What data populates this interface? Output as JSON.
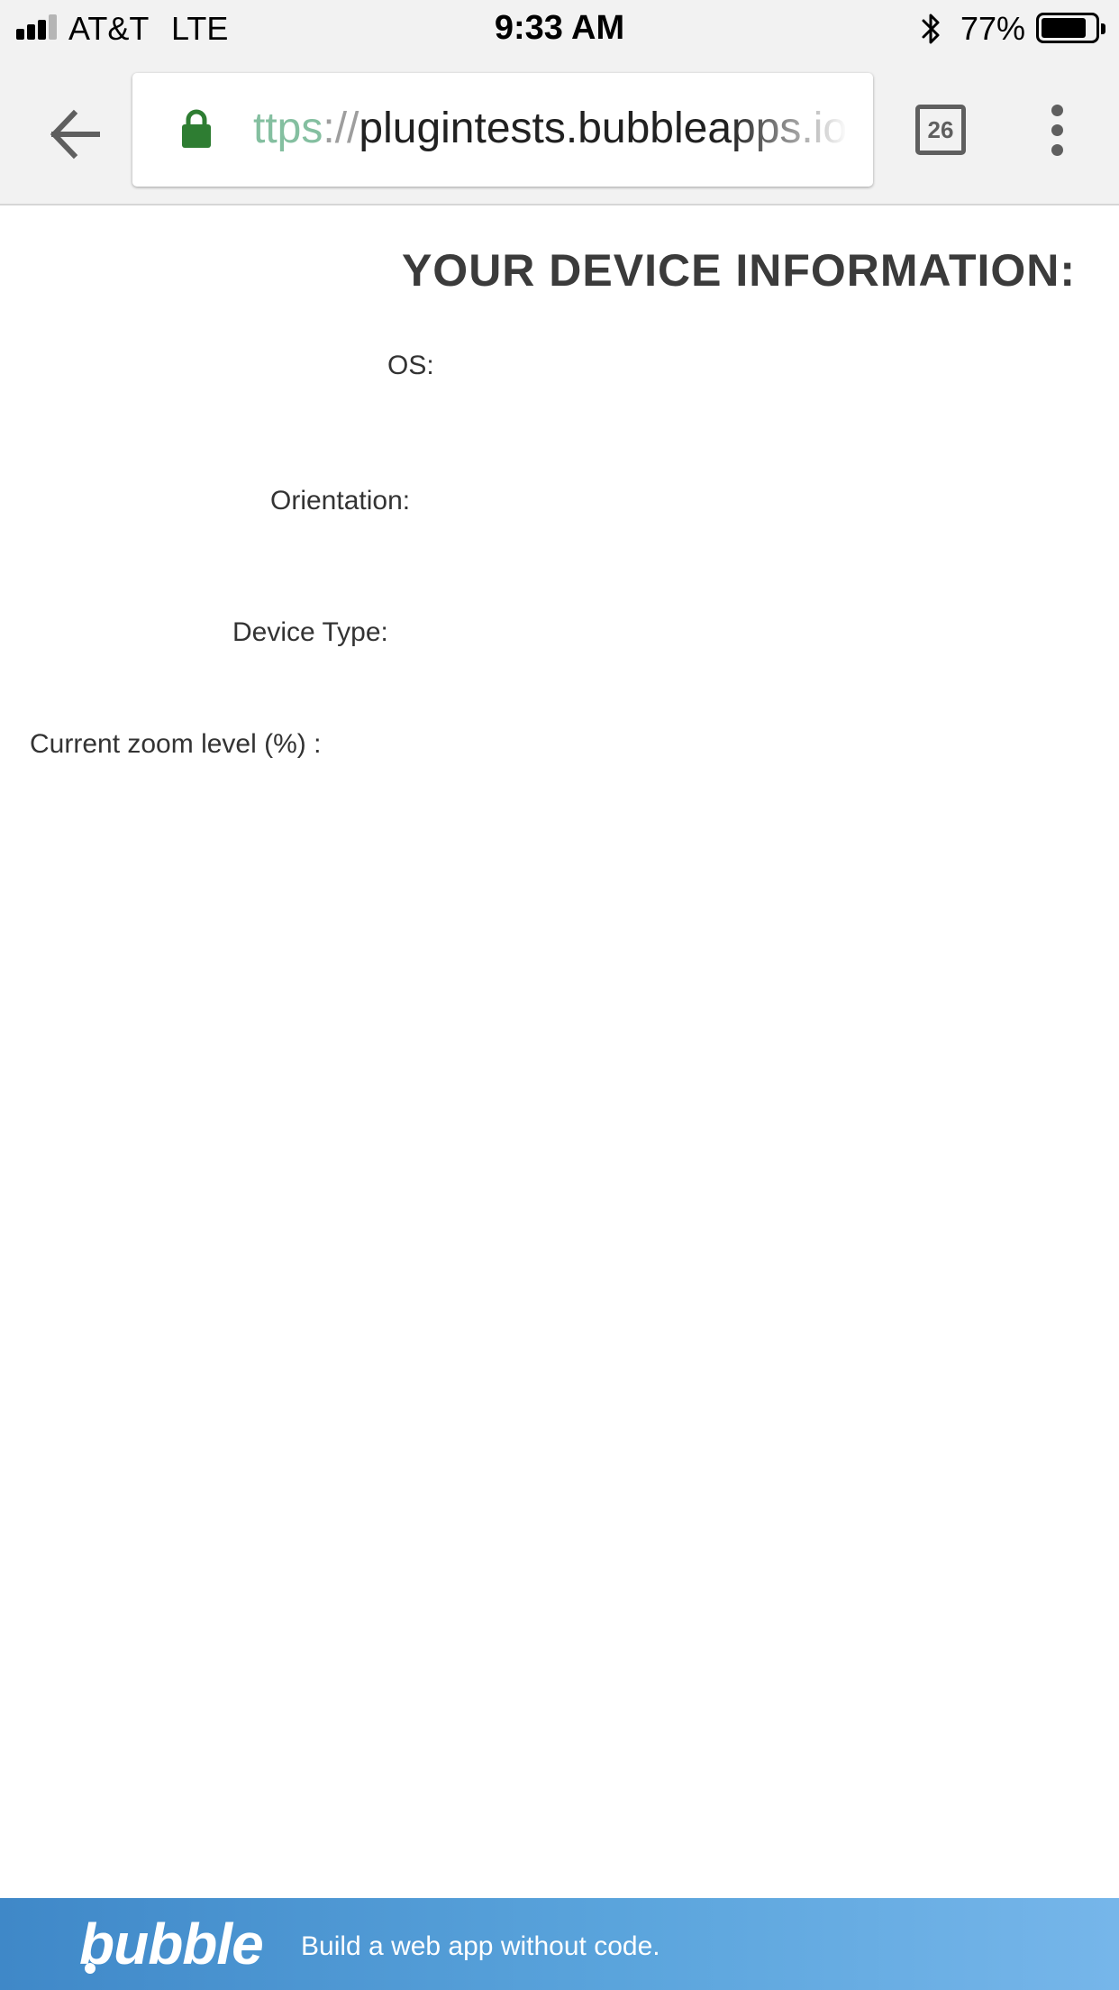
{
  "status_bar": {
    "carrier": "AT&T",
    "network": "LTE",
    "time": "9:33 AM",
    "battery_percent": "77%"
  },
  "toolbar": {
    "url_scheme": "ttps",
    "url_sep": "://",
    "url_host": "plugintests.bubbleapps.io",
    "tab_count": "26"
  },
  "page": {
    "title": "YOUR DEVICE INFORMATION:",
    "labels": {
      "os": "OS:",
      "orientation": "Orientation:",
      "device_type": "Device Type:",
      "zoom": "Current zoom level (%) :"
    }
  },
  "footer": {
    "logo_text": "bubble",
    "tagline": "Build a web app without code."
  },
  "colors": {
    "lock": "#2e7d32",
    "footer_start": "#3f88c8",
    "footer_end": "#76b6ea"
  },
  "icons": {
    "back": "arrow-left-icon",
    "lock": "lock-icon",
    "menu": "more-vert-icon",
    "bluetooth": "bluetooth-icon"
  }
}
